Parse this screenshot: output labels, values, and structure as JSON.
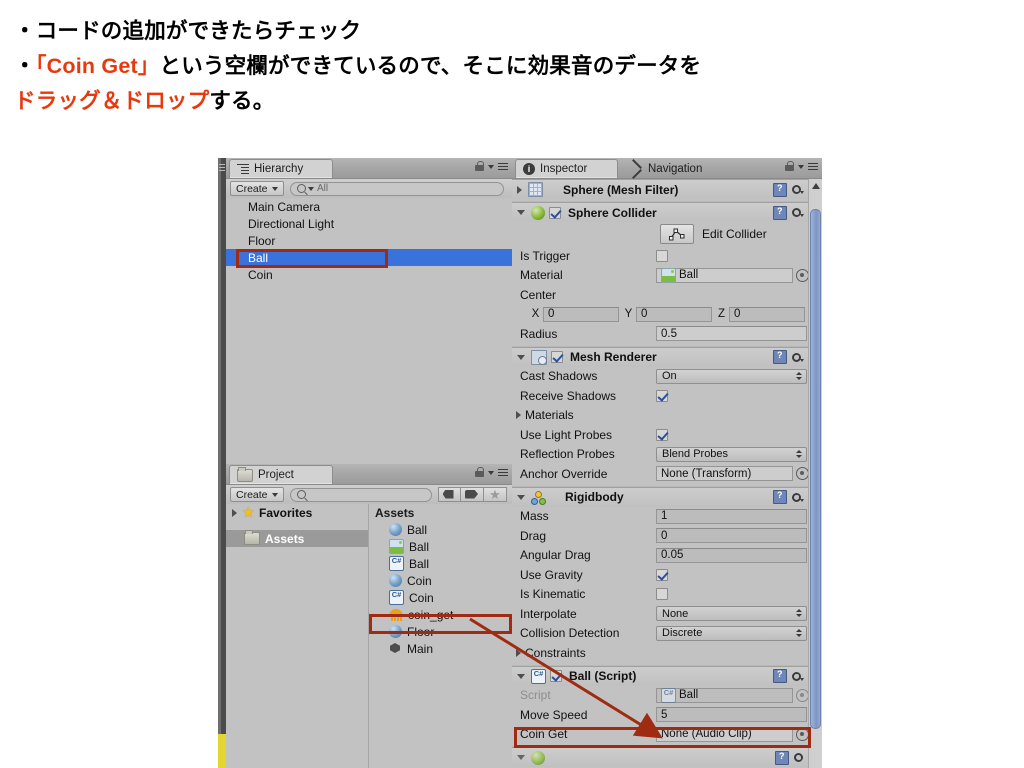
{
  "slide": {
    "line1": "・コードの追加ができたらチェック",
    "line2_bullet": "・",
    "line2_red": "「Coin Get」",
    "line2_rest": "という空欄ができているので、そこに効果音のデータを",
    "line3_red": "ドラッグ＆ドロップ",
    "line3_rest": "する。",
    "accent_color": "#e8380d"
  },
  "hierarchy": {
    "tab_label": "Hierarchy",
    "tab_icon": "hierarchy-icon",
    "create_label": "Create",
    "search_placeholder": "All",
    "items": [
      {
        "label": "Main Camera",
        "selected": false
      },
      {
        "label": "Directional Light",
        "selected": false
      },
      {
        "label": "Floor",
        "selected": false
      },
      {
        "label": "Ball",
        "selected": true
      },
      {
        "label": "Coin",
        "selected": false
      }
    ],
    "selection_color": "#3a72db",
    "highlight_color": "#9e2b12"
  },
  "project": {
    "tab_label": "Project",
    "tab_icon": "folder-icon",
    "create_label": "Create",
    "search_placeholder": "",
    "tree": [
      {
        "label": "Favorites",
        "icon": "star-icon",
        "selected": false
      },
      {
        "label": "Assets",
        "icon": "folder-icon",
        "selected": true
      }
    ],
    "assets_header": "Assets",
    "assets": [
      {
        "label": "Ball",
        "icon": "sphere-icon",
        "highlighted": false
      },
      {
        "label": "Ball",
        "icon": "material-icon",
        "highlighted": false
      },
      {
        "label": "Ball",
        "icon": "csharp-script-icon",
        "highlighted": false
      },
      {
        "label": "Coin",
        "icon": "sphere-icon",
        "highlighted": false
      },
      {
        "label": "Coin",
        "icon": "csharp-script-icon",
        "highlighted": false
      },
      {
        "label": "coin_get",
        "icon": "audio-clip-icon",
        "highlighted": true
      },
      {
        "label": "Floor",
        "icon": "sphere-icon",
        "highlighted": false
      },
      {
        "label": "Main",
        "icon": "unity-scene-icon",
        "highlighted": false
      }
    ]
  },
  "inspector": {
    "tabs": [
      {
        "label": "Inspector",
        "icon": "info-icon",
        "active": true
      },
      {
        "label": "Navigation",
        "icon": "navigation-icon",
        "active": false
      }
    ],
    "components": [
      {
        "title": "Sphere (Mesh Filter)",
        "icon": "mesh-filter-icon",
        "expanded": false,
        "has_enable_checkbox": false,
        "rows": []
      },
      {
        "title": "Sphere Collider",
        "icon": "sphere-collider-icon",
        "expanded": true,
        "has_enable_checkbox": true,
        "enabled": true,
        "edit_collider_label": "Edit Collider",
        "rows": [
          {
            "kind": "checkbox",
            "label": "Is Trigger",
            "checked": false
          },
          {
            "kind": "object",
            "label": "Material",
            "value": "Ball",
            "icon": "material-icon"
          },
          {
            "kind": "header",
            "label": "Center"
          },
          {
            "kind": "vector3",
            "label": "",
            "axes": [
              "X",
              "Y",
              "Z"
            ],
            "values": [
              "0",
              "0",
              "0"
            ]
          },
          {
            "kind": "text",
            "label": "Radius",
            "value": "0.5"
          }
        ]
      },
      {
        "title": "Mesh Renderer",
        "icon": "mesh-renderer-icon",
        "expanded": true,
        "has_enable_checkbox": true,
        "enabled": true,
        "rows": [
          {
            "kind": "popup",
            "label": "Cast Shadows",
            "value": "On"
          },
          {
            "kind": "checkbox",
            "label": "Receive Shadows",
            "checked": true
          },
          {
            "kind": "foldout",
            "label": "Materials"
          },
          {
            "kind": "checkbox",
            "label": "Use Light Probes",
            "checked": true
          },
          {
            "kind": "popup",
            "label": "Reflection Probes",
            "value": "Blend Probes"
          },
          {
            "kind": "object",
            "label": "Anchor Override",
            "value": "None (Transform)"
          }
        ]
      },
      {
        "title": "Rigidbody",
        "icon": "rigidbody-icon",
        "expanded": true,
        "has_enable_checkbox": false,
        "rows": [
          {
            "kind": "text",
            "label": "Mass",
            "value": "1"
          },
          {
            "kind": "text",
            "label": "Drag",
            "value": "0"
          },
          {
            "kind": "text",
            "label": "Angular Drag",
            "value": "0.05"
          },
          {
            "kind": "checkbox",
            "label": "Use Gravity",
            "checked": true
          },
          {
            "kind": "checkbox",
            "label": "Is Kinematic",
            "checked": false
          },
          {
            "kind": "popup",
            "label": "Interpolate",
            "value": "None"
          },
          {
            "kind": "popup",
            "label": "Collision Detection",
            "value": "Discrete"
          },
          {
            "kind": "foldout",
            "label": "Constraints"
          }
        ]
      },
      {
        "title": "Ball (Script)",
        "icon": "csharp-script-icon",
        "expanded": true,
        "has_enable_checkbox": true,
        "enabled": true,
        "rows": [
          {
            "kind": "object",
            "label": "Script",
            "value": "Ball",
            "icon": "csharp-script-icon",
            "dim": true
          },
          {
            "kind": "text",
            "label": "Move Speed",
            "value": "5"
          },
          {
            "kind": "object",
            "label": "Coin Get",
            "value": "None (Audio Clip)",
            "highlighted": true
          }
        ]
      }
    ]
  },
  "annotations": {
    "arrow_color": "#9e2b12",
    "arrow_from_label": "coin_get",
    "arrow_to_label": "Coin Get"
  }
}
